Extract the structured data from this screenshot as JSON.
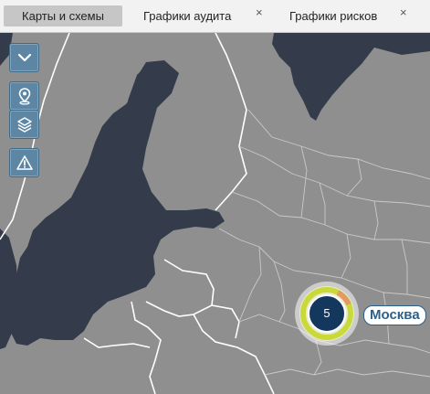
{
  "tabs": [
    {
      "label": "Карты и схемы",
      "active": true,
      "closable": false
    },
    {
      "label": "Графики аудита",
      "active": false,
      "closable": true
    },
    {
      "label": "Графики рисков",
      "active": false,
      "closable": true
    }
  ],
  "close_glyph": "×",
  "map_controls": [
    {
      "icon": "chevron-down-icon"
    },
    {
      "icon": "map-pin-icon"
    },
    {
      "icon": "layers-icon"
    },
    {
      "icon": "warning-icon"
    }
  ],
  "cluster": {
    "count": "5",
    "city_label": "Москва"
  },
  "colors": {
    "land": "#8f8f8f",
    "water": "#343b4a",
    "border": "#ffffff",
    "control": "#5c86a3",
    "cluster_ring": "#c9d93a",
    "cluster_core": "#14375e",
    "label": "#2c5f8a"
  }
}
